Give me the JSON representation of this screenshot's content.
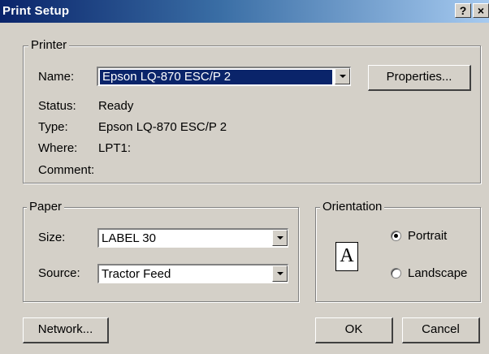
{
  "window": {
    "title": "Print Setup",
    "help_button": "?",
    "close_button": "×"
  },
  "printer": {
    "legend": "Printer",
    "name_label": "Name:",
    "name_value": "Epson LQ-870 ESC/P 2",
    "properties_button": "Properties...",
    "status_label": "Status:",
    "status_value": "Ready",
    "type_label": "Type:",
    "type_value": "Epson LQ-870 ESC/P 2",
    "where_label": "Where:",
    "where_value": "LPT1:",
    "comment_label": "Comment:",
    "comment_value": ""
  },
  "paper": {
    "legend": "Paper",
    "size_label": "Size:",
    "size_value": "LABEL 30",
    "source_label": "Source:",
    "source_value": "Tractor Feed"
  },
  "orientation": {
    "legend": "Orientation",
    "icon_letter": "A",
    "portrait_label": "Portrait",
    "landscape_label": "Landscape",
    "selected": "Portrait"
  },
  "buttons": {
    "network": "Network...",
    "ok": "OK",
    "cancel": "Cancel"
  },
  "colors": {
    "dialog_bg": "#d4d0c8",
    "titlebar_start": "#0a246a",
    "titlebar_end": "#a6caf0",
    "selection": "#0a246a"
  }
}
